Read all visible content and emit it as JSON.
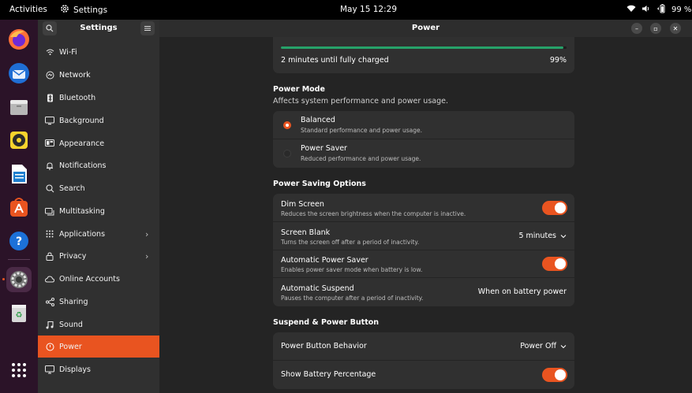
{
  "topbar": {
    "activities": "Activities",
    "app_name": "Settings",
    "clock": "May 15  12:29",
    "battery": "99 %"
  },
  "sidebar": {
    "title": "Settings",
    "items": [
      {
        "label": "Wi-Fi",
        "icon": "wifi-icon"
      },
      {
        "label": "Network",
        "icon": "network-icon"
      },
      {
        "label": "Bluetooth",
        "icon": "bluetooth-icon"
      },
      {
        "label": "Background",
        "icon": "background-icon"
      },
      {
        "label": "Appearance",
        "icon": "appearance-icon"
      },
      {
        "label": "Notifications",
        "icon": "bell-icon"
      },
      {
        "label": "Search",
        "icon": "search-icon"
      },
      {
        "label": "Multitasking",
        "icon": "multitasking-icon"
      },
      {
        "label": "Applications",
        "icon": "grid-icon"
      },
      {
        "label": "Privacy",
        "icon": "lock-icon"
      },
      {
        "label": "Online Accounts",
        "icon": "cloud-icon"
      },
      {
        "label": "Sharing",
        "icon": "share-icon"
      },
      {
        "label": "Sound",
        "icon": "music-note-icon"
      },
      {
        "label": "Power",
        "icon": "power-icon"
      },
      {
        "label": "Displays",
        "icon": "display-icon"
      }
    ]
  },
  "main": {
    "title": "Power",
    "battery": {
      "status": "2 minutes until fully charged",
      "percent": "99%",
      "level": 0.99
    },
    "power_mode": {
      "title": "Power Mode",
      "subtitle": "Affects system performance and power usage.",
      "options": [
        {
          "title": "Balanced",
          "desc": "Standard performance and power usage.",
          "selected": true
        },
        {
          "title": "Power Saver",
          "desc": "Reduced performance and power usage.",
          "selected": false
        }
      ]
    },
    "saving": {
      "title": "Power Saving Options",
      "dim_screen": {
        "title": "Dim Screen",
        "desc": "Reduces the screen brightness when the computer is inactive.",
        "on": true
      },
      "screen_blank": {
        "title": "Screen Blank",
        "desc": "Turns the screen off after a period of inactivity.",
        "value": "5 minutes"
      },
      "auto_saver": {
        "title": "Automatic Power Saver",
        "desc": "Enables power saver mode when battery is low.",
        "on": true
      },
      "auto_suspend": {
        "title": "Automatic Suspend",
        "desc": "Pauses the computer after a period of inactivity.",
        "value": "When on battery power"
      }
    },
    "suspend": {
      "title": "Suspend & Power Button",
      "button_behavior": {
        "title": "Power Button Behavior",
        "value": "Power Off"
      },
      "battery_pct": {
        "title": "Show Battery Percentage",
        "on": true
      }
    }
  },
  "colors": {
    "accent": "#e95420",
    "dock": "#2b1328",
    "sidebar": "#303030",
    "content": "#242424",
    "battery_bar": "#26a269"
  }
}
